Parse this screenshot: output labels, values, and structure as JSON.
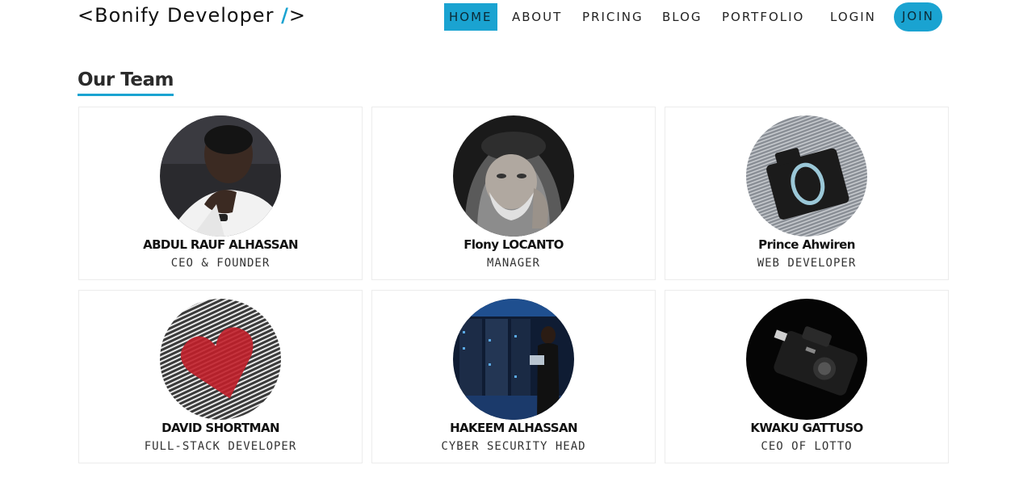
{
  "brand": {
    "open": "<",
    "name": "Bonify Developer ",
    "slash": "/",
    "close": ">"
  },
  "nav": {
    "items": [
      "HOME",
      "ABOUT",
      "PRICING",
      "BLOG",
      "PORTFOLIO",
      "LOGIN"
    ],
    "active": "HOME",
    "join": "JOIN"
  },
  "colors": {
    "accent": "#1aa3d1"
  },
  "section": {
    "title": "Our Team"
  },
  "team": [
    {
      "name": "ABDUL RAUF ALHASSAN",
      "role": "CEO & FOUNDER",
      "photo": "man-portrait-photo"
    },
    {
      "name": "Flony LOCANTO",
      "role": "MANAGER",
      "photo": "old-man-bw-photo"
    },
    {
      "name": "Prince Ahwiren",
      "role": "WEB DEVELOPER",
      "photo": "camera-binary-photo"
    },
    {
      "name": "DAVID SHORTMAN",
      "role": "FULL-STACK DEVELOPER",
      "photo": "heart-binary-photo"
    },
    {
      "name": "HAKEEM ALHASSAN",
      "role": "CYBER SECURITY HEAD",
      "photo": "server-room-photo"
    },
    {
      "name": "KWAKU GATTUSO",
      "role": "CEO OF LOTTO",
      "photo": "camera-dark-photo"
    }
  ]
}
